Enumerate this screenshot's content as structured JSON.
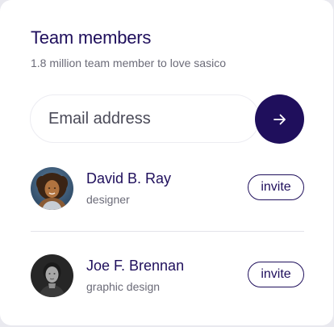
{
  "colors": {
    "primary": "#1f0f5c",
    "muted_text": "#6b6b78",
    "background": "#ffffff"
  },
  "card": {
    "title": "Team members",
    "subtitle": "1.8 million team member to love sasico"
  },
  "email": {
    "value": "",
    "placeholder": "Email address",
    "submit_icon": "arrow-right-icon"
  },
  "members": [
    {
      "name": "David B. Ray",
      "role": "designer",
      "action_label": "invite",
      "avatar_icon": "avatar-photo"
    },
    {
      "name": "Joe F. Brennan",
      "role": "graphic design",
      "action_label": "invite",
      "avatar_icon": "avatar-photo"
    }
  ]
}
